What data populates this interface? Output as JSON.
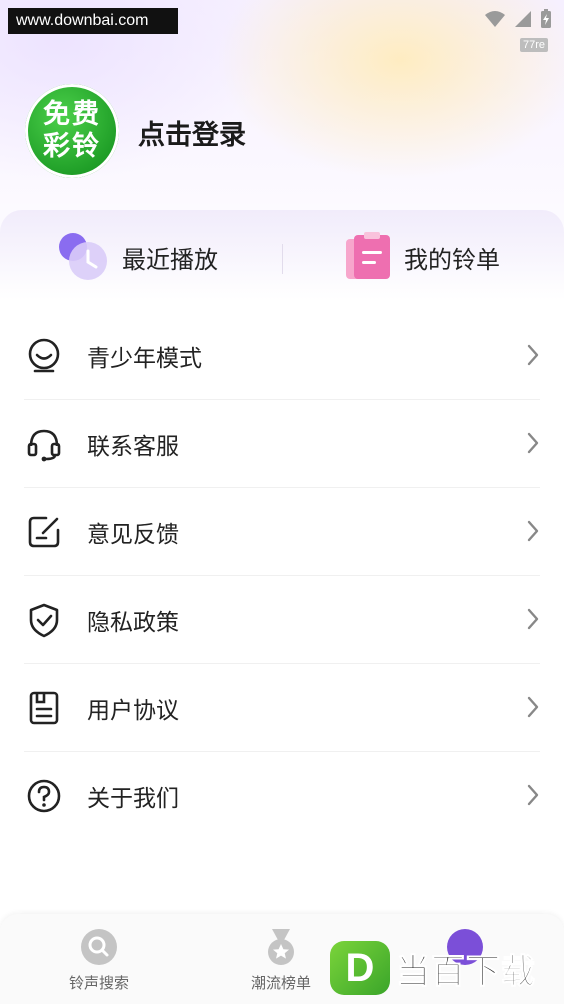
{
  "watermark_top": "www.downbai.com",
  "status": {
    "net_speed": "77re"
  },
  "profile": {
    "avatar_line1": "免费",
    "avatar_line2": "彩铃",
    "login_label": "点击登录"
  },
  "quick": {
    "recent_label": "最近播放",
    "mylist_label": "我的铃单"
  },
  "menu": [
    {
      "label": "青少年模式",
      "icon": "child-face-icon"
    },
    {
      "label": "联系客服",
      "icon": "headset-icon"
    },
    {
      "label": "意见反馈",
      "icon": "feedback-edit-icon"
    },
    {
      "label": "隐私政策",
      "icon": "shield-check-icon"
    },
    {
      "label": "用户协议",
      "icon": "document-icon"
    },
    {
      "label": "关于我们",
      "icon": "question-circle-icon"
    }
  ],
  "bottom_nav": {
    "search_label": "铃声搜索",
    "rank_label": "潮流榜单"
  },
  "watermark_bottom": {
    "logo_letter": "D",
    "text": "当百下载"
  },
  "colors": {
    "avatar_green": "#22a62a",
    "accent_purple": "#9b7df0",
    "accent_pink": "#f06fb0"
  }
}
